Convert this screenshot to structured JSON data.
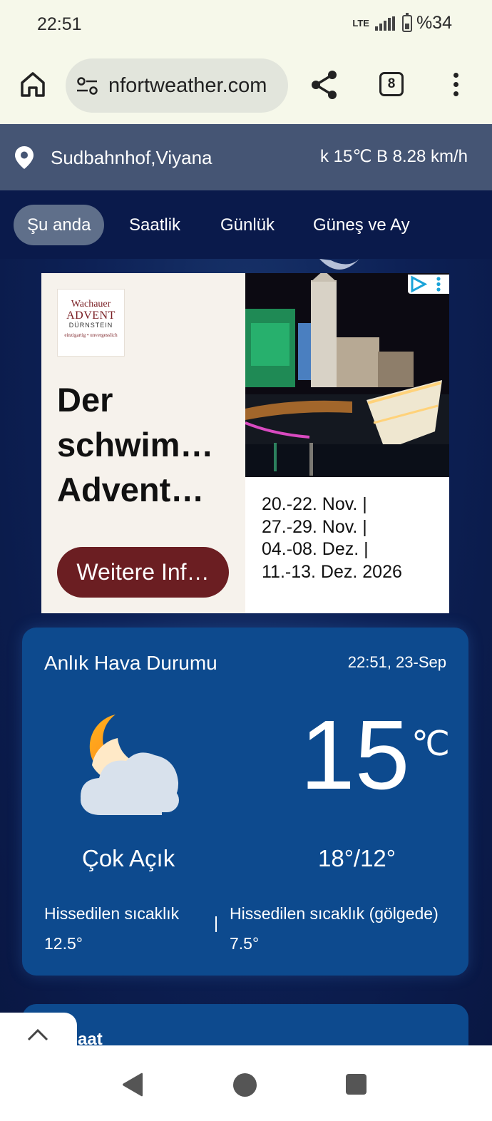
{
  "status_bar": {
    "time": "22:51",
    "network": "LTE",
    "battery": "%34"
  },
  "browser": {
    "url": "nfortweather.com",
    "tab_count": "8"
  },
  "location_bar": {
    "name": "Sudbahnhof,Viyana",
    "summary": "k   15℃   B 8.28 km/h"
  },
  "tabs": [
    "Şu anda",
    "Saatlik",
    "Günlük",
    "Güneş ve Ay"
  ],
  "ad": {
    "logo": {
      "line1": "Wachauer",
      "line2": "ADVENT",
      "line3": "DÜRNSTEIN",
      "line4": "einzigartig • unvergesslich"
    },
    "headline": "Der schwim… Advent…",
    "button": "Weitere Inf…",
    "dates": "20.-22. Nov. |\n27.-29. Nov. |\n04.-08. Dez. |\n11.-13. Dez. 2026"
  },
  "current": {
    "title": "Anlık Hava Durumu",
    "datetime": "22:51, 23-Sep",
    "temp": "15",
    "unit": "℃",
    "condition": "Çok Açık",
    "hi_lo": "18°/12°",
    "feels_like": "Hissedilen sıcaklık 12.5°",
    "feels_shade": "Hissedilen sıcaklık (gölgede) 7.5°"
  },
  "next_card": {
    "title": "Saat"
  }
}
